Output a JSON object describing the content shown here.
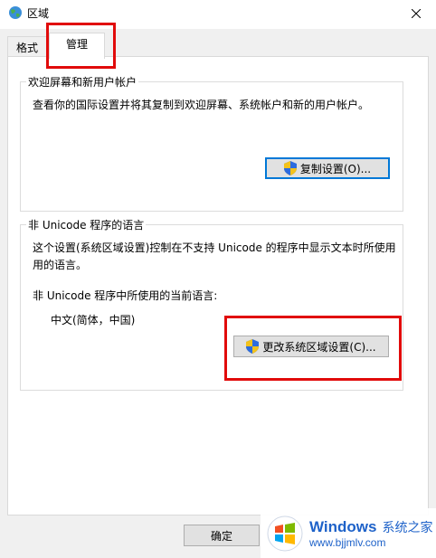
{
  "window": {
    "title": "区域",
    "app_icon": "globe-icon",
    "close_icon": "close-icon"
  },
  "tabs": [
    {
      "label": "格式",
      "active": false
    },
    {
      "label": "管理",
      "active": true
    }
  ],
  "welcome_group": {
    "title": "欢迎屏幕和新用户帐户",
    "description": "查看你的国际设置并将其复制到欢迎屏幕、系统帐户和新的用户帐户。",
    "button_label": "复制设置(O)...",
    "button_icon": "uac-shield-icon"
  },
  "unicode_group": {
    "title": "非 Unicode 程序的语言",
    "description_line1": "这个设置(系统区域设置)控制在不支持 Unicode 的程序中显示文本时所使用",
    "description_line2": "用的语言。",
    "current_label": "非 Unicode 程序中所使用的当前语言:",
    "current_value": "中文(简体，中国)",
    "button_label": "更改系统区域设置(C)...",
    "button_icon": "uac-shield-icon"
  },
  "footer": {
    "ok_label": "确定"
  },
  "watermark": {
    "brand": "Windows",
    "cn": "系统之家",
    "url": "www.bjjmlv.com"
  },
  "colors": {
    "highlight": "#e10b0b",
    "accent": "#0078d7"
  }
}
